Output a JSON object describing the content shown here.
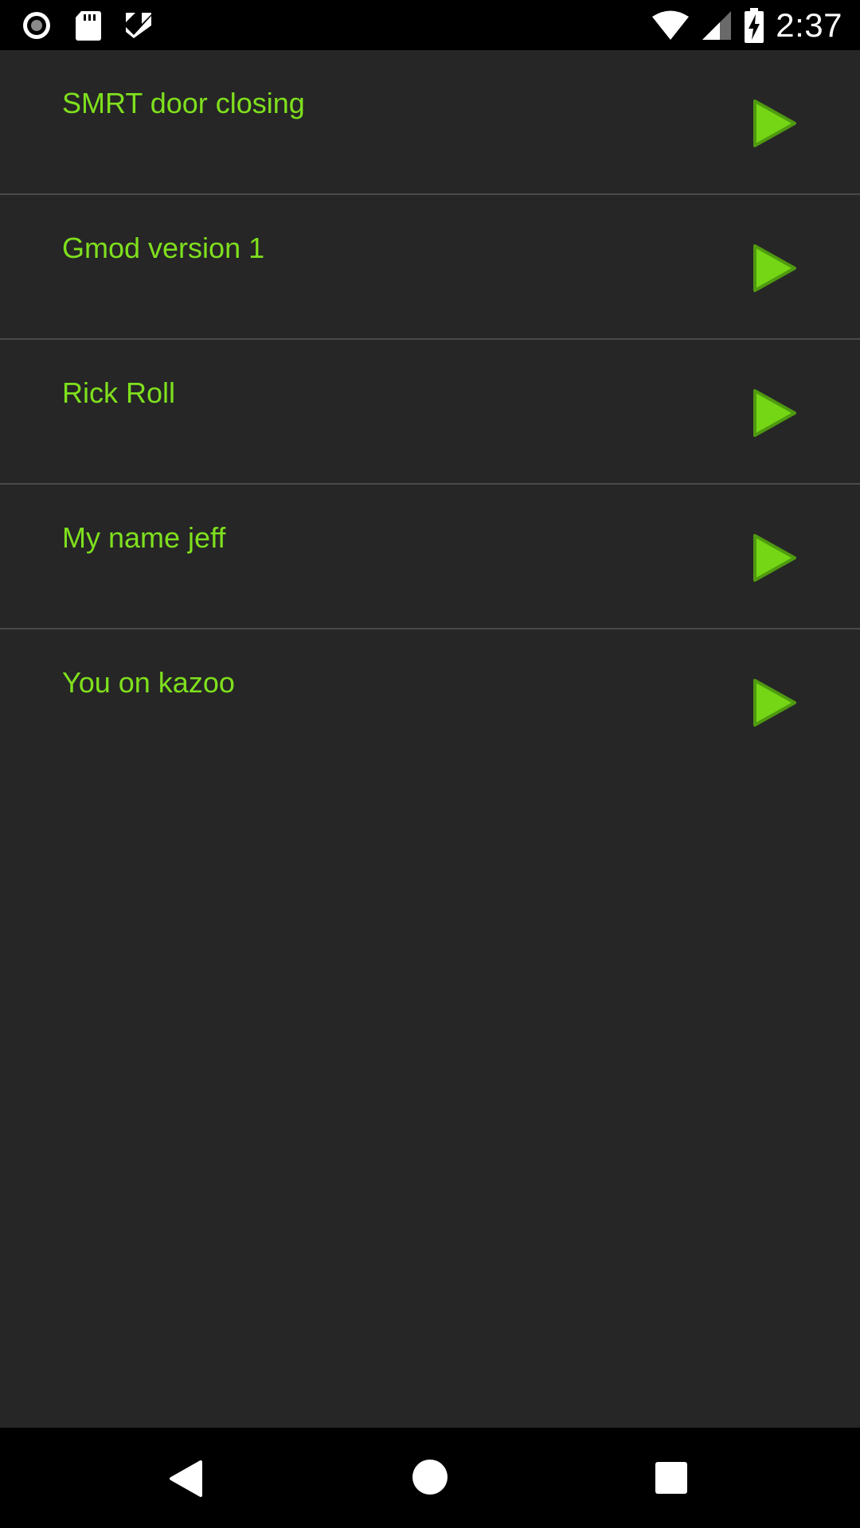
{
  "status_bar": {
    "time": "2:37",
    "left_icons": [
      "record-icon",
      "sd-card-icon",
      "checklist-icon"
    ],
    "right_icons": [
      "wifi-icon",
      "cell-signal-icon",
      "battery-charging-icon"
    ]
  },
  "sounds": [
    {
      "label": "SMRT door closing",
      "icon": "play-icon"
    },
    {
      "label": "Gmod version 1",
      "icon": "play-icon"
    },
    {
      "label": "Rick Roll",
      "icon": "play-icon"
    },
    {
      "label": "My name jeff",
      "icon": "play-icon"
    },
    {
      "label": "You on kazoo",
      "icon": "play-icon"
    }
  ],
  "nav_bar": {
    "buttons": [
      "back-icon",
      "home-icon",
      "recents-icon"
    ]
  },
  "colors": {
    "background": "#262626",
    "bars": "#000000",
    "accent_text": "#7fe01d",
    "play_fill": "#74d614",
    "play_stroke": "#4f9a10",
    "divider": "#4a4a4a"
  }
}
